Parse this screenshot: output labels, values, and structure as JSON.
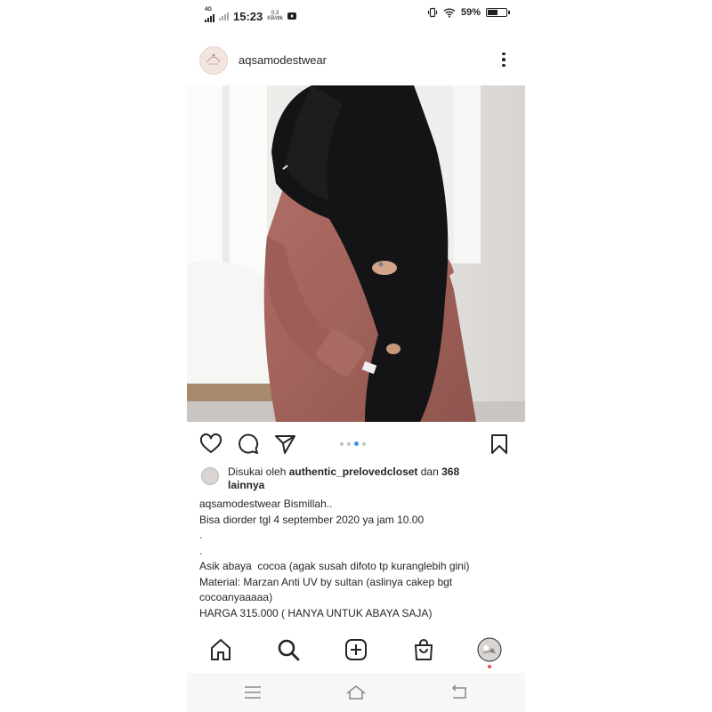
{
  "status_bar": {
    "network": "4G",
    "time": "15:23",
    "speed_value": "0,3",
    "speed_unit": "KB/dtk",
    "battery_percent_label": "59%",
    "battery_level": 0.59
  },
  "post": {
    "username": "aqsamodestwear",
    "avatar_icon": "brand-logo-avatar",
    "carousel": {
      "count": 4,
      "active_index": 2
    },
    "likes": {
      "prefix": "Disukai oleh ",
      "liker": "authentic_preloved​closet",
      "connector": " dan ",
      "count_text": "368",
      "suffix": "lainnya"
    },
    "caption": {
      "author": "aqsamodestwear",
      "first": " Bismillah..",
      "lines": [
        "Bisa diorder tgl 4 september 2020 ya jam 10.00",
        ".",
        ".",
        "Asik abaya  cocoa (agak susah difoto tp kuranglebih gini)",
        "Material: Marzan Anti UV by sultan (aslinya cakep bgt",
        "cocoanyaaaaa)",
        "HARGA 315.000 ( HANYA UNTUK ABAYA SAJA)"
      ]
    }
  },
  "colors": {
    "accent": "#3897f0",
    "notification": "#ed4956",
    "abaya": "#a2635b",
    "khimar": "#121214"
  },
  "icons": {
    "like": "heart-icon",
    "comment": "comment-icon",
    "share": "send-icon",
    "save": "bookmark-icon",
    "home": "home-icon",
    "search": "search-icon",
    "create": "add-post-icon",
    "shop": "shopping-bag-icon",
    "profile": "profile-avatar-icon"
  }
}
